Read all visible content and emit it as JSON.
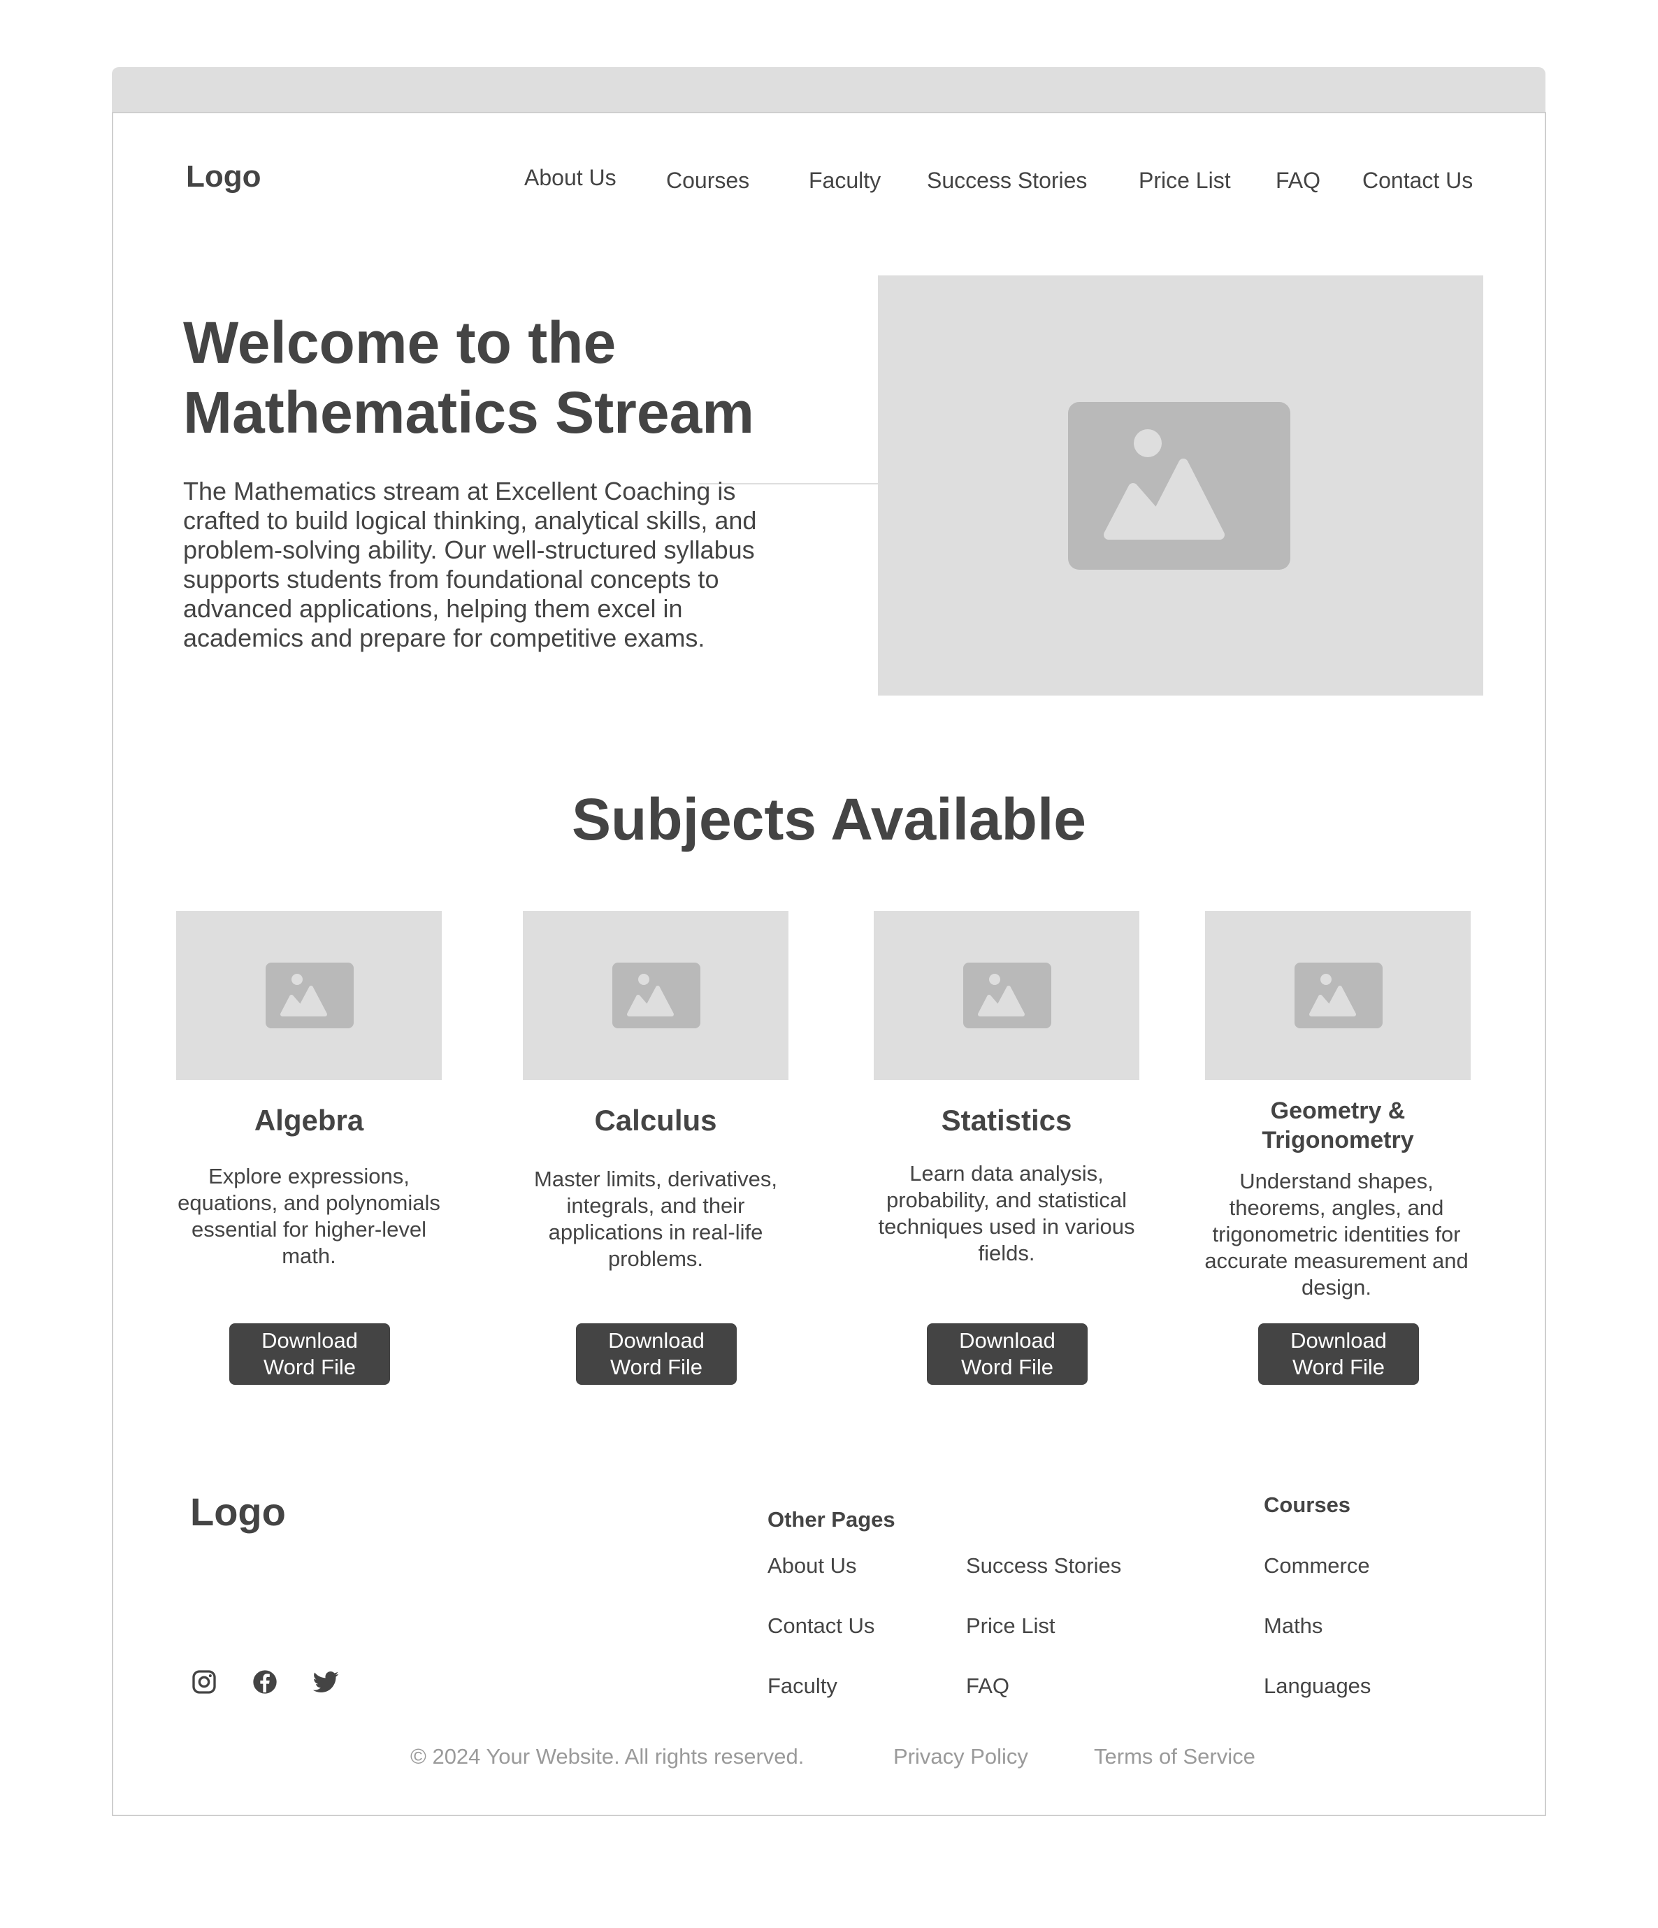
{
  "header": {
    "logo": "Logo",
    "nav": [
      "About Us",
      "Courses",
      "Faculty",
      "Success Stories",
      "Price List",
      "FAQ",
      "Contact Us"
    ]
  },
  "hero": {
    "title_line1": "Welcome to the",
    "title_line2": "Mathematics Stream",
    "description": "The Mathematics stream at Excellent Coaching is crafted to build logical thinking, analytical skills, and problem-solving ability. Our well-structured syllabus supports students from foundational concepts to advanced applications, helping them excel in academics and prepare for competitive exams.",
    "image_icon": "image-placeholder-icon"
  },
  "subjects": {
    "heading": "Subjects Available",
    "button_label": "Download Word File",
    "items": [
      {
        "title": "Algebra",
        "description": "Explore expressions, equations, and polynomials essential for higher-level math."
      },
      {
        "title": "Calculus",
        "description": "Master limits, derivatives, integrals, and their applications in real-life problems."
      },
      {
        "title": "Statistics",
        "description": "Learn data analysis, probability, and statistical techniques used in various fields."
      },
      {
        "title": "Geometry & Trigonometry",
        "description": "Understand shapes, theorems, angles, and trigonometric identities for accurate measurement and design."
      }
    ]
  },
  "footer": {
    "logo": "Logo",
    "other_pages_heading": "Other Pages",
    "other_pages": [
      "About Us",
      "Contact Us",
      "Faculty",
      "Success Stories",
      "Price List",
      "FAQ"
    ],
    "courses_heading": "Courses",
    "courses": [
      "Commerce",
      "Maths",
      "Languages"
    ],
    "social_icons": [
      "instagram-icon",
      "facebook-icon",
      "twitter-icon"
    ],
    "copyright": "© 2024 Your Website. All rights reserved.",
    "privacy": "Privacy Policy",
    "terms": "Terms of Service"
  },
  "colors": {
    "text": "#444444",
    "placeholder": "#dedede",
    "placeholder_icon": "#b9b9b9",
    "button": "#444444",
    "muted": "#9a9a9a"
  }
}
